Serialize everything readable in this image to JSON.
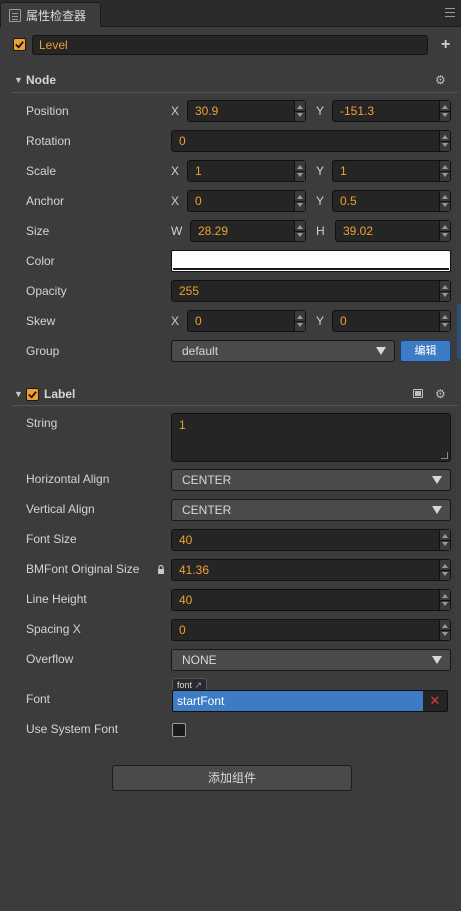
{
  "panel": {
    "title": "属性检查器"
  },
  "node_name": {
    "value": "Level"
  },
  "node_section": {
    "title": "Node",
    "position": {
      "label": "Position",
      "x_axis": "X",
      "x": "30.9",
      "y_axis": "Y",
      "y": "-151.3"
    },
    "rotation": {
      "label": "Rotation",
      "value": "0"
    },
    "scale": {
      "label": "Scale",
      "x_axis": "X",
      "x": "1",
      "y_axis": "Y",
      "y": "1"
    },
    "anchor": {
      "label": "Anchor",
      "x_axis": "X",
      "x": "0",
      "y_axis": "Y",
      "y": "0.5"
    },
    "size": {
      "label": "Size",
      "w_axis": "W",
      "w": "28.29",
      "h_axis": "H",
      "h": "39.02"
    },
    "color": {
      "label": "Color",
      "value": "#ffffff"
    },
    "opacity": {
      "label": "Opacity",
      "value": "255"
    },
    "skew": {
      "label": "Skew",
      "x_axis": "X",
      "x": "0",
      "y_axis": "Y",
      "y": "0"
    },
    "group": {
      "label": "Group",
      "value": "default",
      "edit_button": "编辑"
    }
  },
  "label_section": {
    "title": "Label",
    "string": {
      "label": "String",
      "value": "1"
    },
    "horizontal_align": {
      "label": "Horizontal Align",
      "value": "CENTER"
    },
    "vertical_align": {
      "label": "Vertical Align",
      "value": "CENTER"
    },
    "font_size": {
      "label": "Font Size",
      "value": "40"
    },
    "bmfont_original_size": {
      "label": "BMFont Original Size",
      "value": "41.36"
    },
    "line_height": {
      "label": "Line Height",
      "value": "40"
    },
    "spacing_x": {
      "label": "Spacing X",
      "value": "0"
    },
    "overflow": {
      "label": "Overflow",
      "value": "NONE"
    },
    "font": {
      "label": "Font",
      "asset_type": "font",
      "value": "startFont",
      "clear_glyph": "✕"
    },
    "use_system_font": {
      "label": "Use System Font",
      "checked": false
    }
  },
  "add_component": {
    "label": "添加组件"
  },
  "colors": {
    "accent": "#f0a030",
    "highlight": "#3d7cc4",
    "background": "#3c3c3c"
  }
}
